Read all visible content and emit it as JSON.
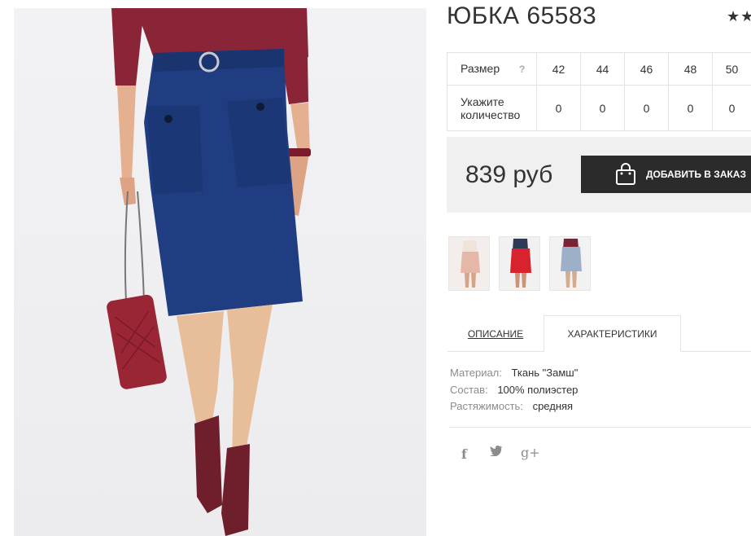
{
  "product": {
    "title": "ЮБКА 65583",
    "rating_stars": "★★"
  },
  "sizes": {
    "size_label": "Размер",
    "help_icon": "?",
    "values": [
      "42",
      "44",
      "46",
      "48",
      "50"
    ],
    "qty_label": "Укажите количество",
    "quantities": [
      "0",
      "0",
      "0",
      "0",
      "0"
    ]
  },
  "price": {
    "text": "839 руб",
    "button_label": "ДОБАВИТЬ В ЗАКАЗ"
  },
  "thumbnails": [
    {
      "icon": "thumbnail-pink-skirt",
      "color": "#e5b7a7"
    },
    {
      "icon": "thumbnail-red-skirt",
      "color": "#d8232f"
    },
    {
      "icon": "thumbnail-blue-skirt",
      "color": "#9db0c8"
    }
  ],
  "tabs": {
    "description": "ОПИСАНИЕ",
    "characteristics": "ХАРАКТЕРИСТИКИ"
  },
  "characteristics": [
    {
      "key": "Материал:",
      "value": "Ткань \"Замш\""
    },
    {
      "key": "Состав:",
      "value": "100% полиэстер"
    },
    {
      "key": "Растяжимость:",
      "value": "средняя"
    }
  ],
  "social": {
    "facebook": "f",
    "twitter": "t",
    "googleplus": "g+"
  },
  "colors": {
    "accent_dark": "#2b2b2b",
    "skirt": "#1f3d80",
    "sweater": "#8a2437"
  }
}
